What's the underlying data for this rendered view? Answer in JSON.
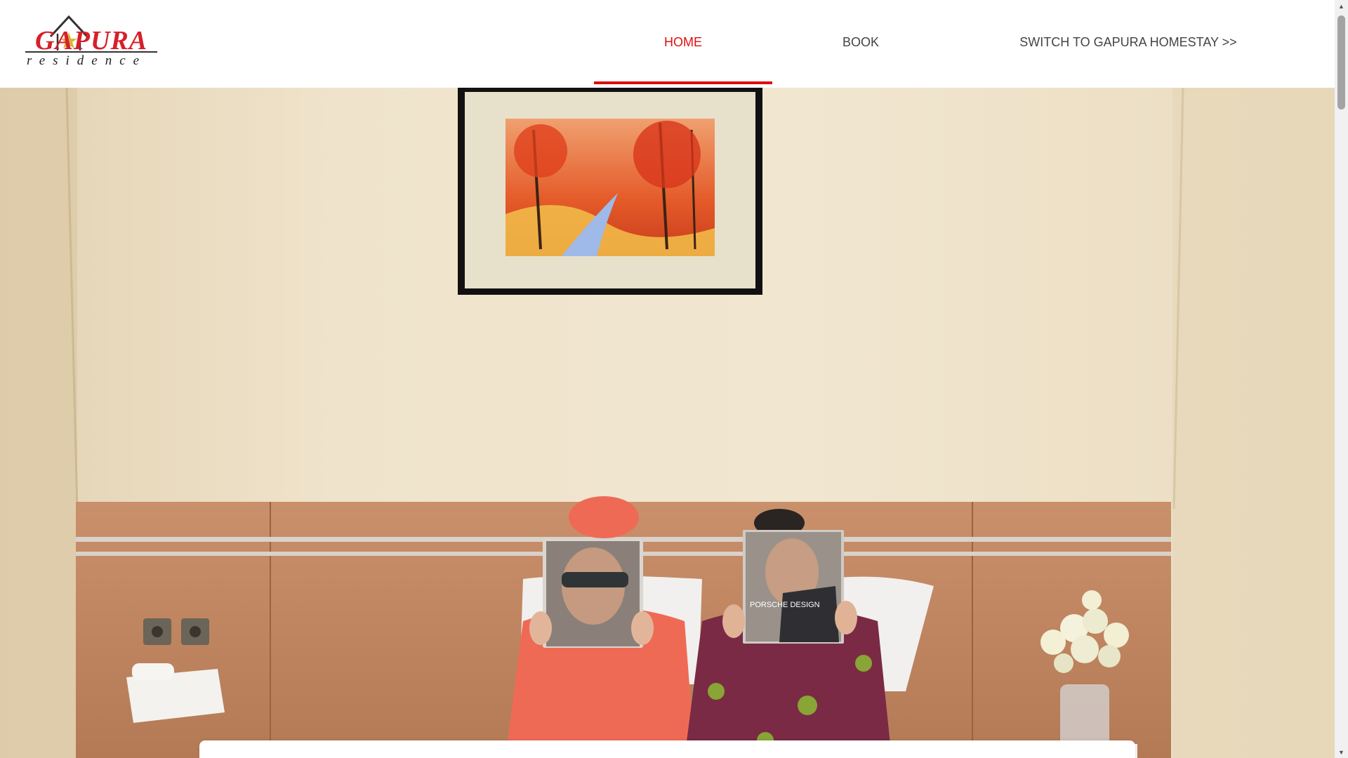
{
  "brand": {
    "logo_name": "GAPURA",
    "logo_sub": "residence",
    "colors": {
      "red": "#d6202a",
      "dark": "#222222"
    }
  },
  "nav": {
    "items": [
      {
        "label": "HOME",
        "active": true
      },
      {
        "label": "BOOK",
        "active": false
      },
      {
        "label": "SWITCH TO GAPURA HOMESTAY >>",
        "active": false
      }
    ],
    "active_color": "#e10e0e",
    "text_color": "#444444"
  },
  "hero": {
    "image": "hotel-room-couple-with-magazines",
    "magazine_text": "PORSCHE DESIGN"
  },
  "scrollbar": {
    "up_icon": "▲",
    "down_icon": "▼"
  }
}
